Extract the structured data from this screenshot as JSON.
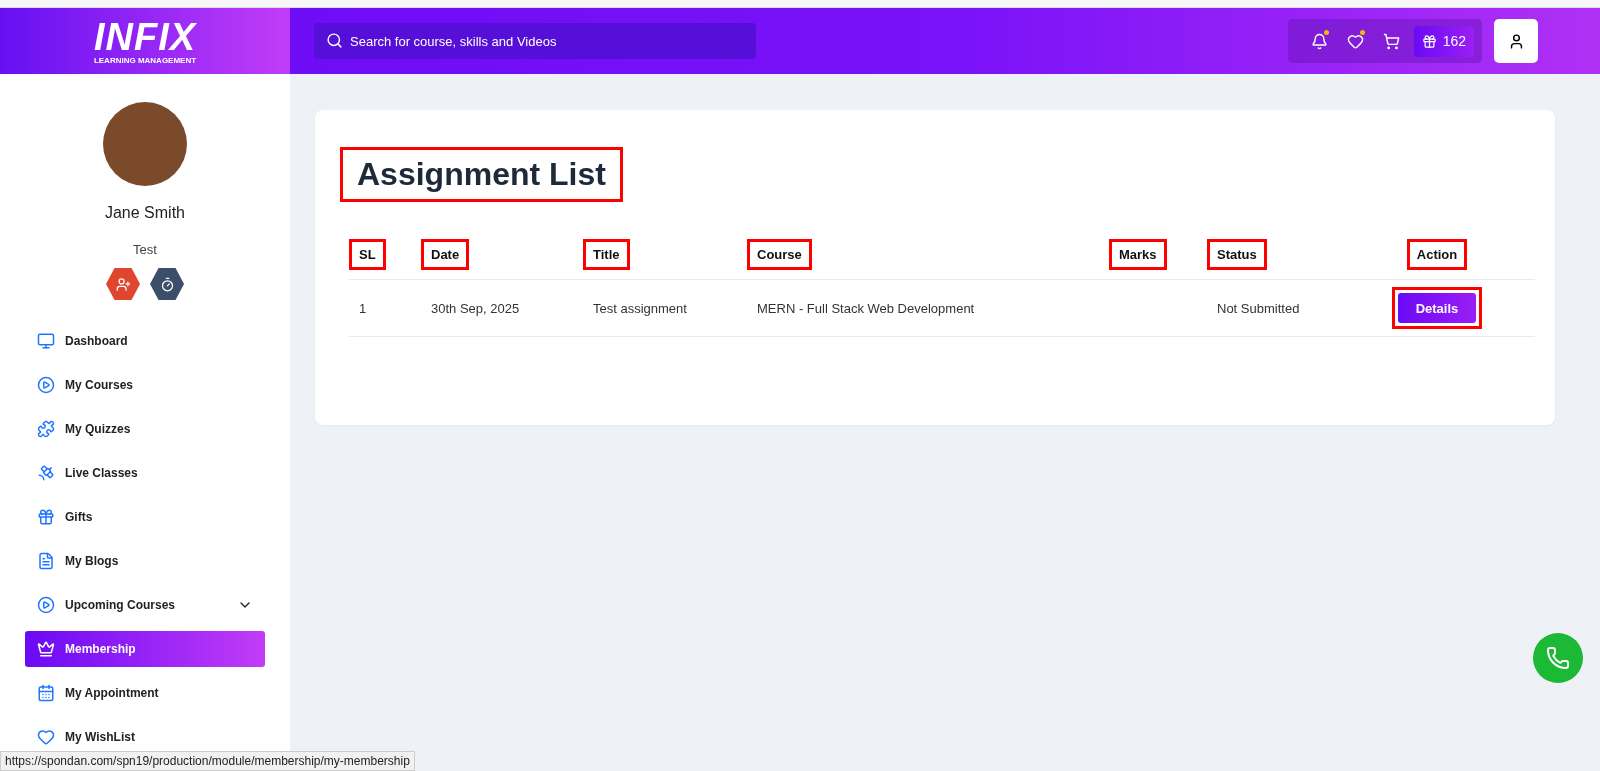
{
  "header": {
    "logo": "INFIX",
    "logo_subtitle": "LEARNING MANAGEMENT",
    "search": {
      "placeholder": "Search for course, skills and Videos"
    },
    "notifications_unread": true,
    "wishlist_unread": true,
    "gift_points": "162"
  },
  "profile": {
    "name": "Jane Smith",
    "role": "Test"
  },
  "sidebar": {
    "items": [
      {
        "kind": "monitor",
        "label": "Dashboard",
        "selected": false
      },
      {
        "kind": "play",
        "label": "My Courses",
        "selected": false
      },
      {
        "kind": "puzzle",
        "label": "My Quizzes",
        "selected": false
      },
      {
        "kind": "satellite",
        "label": "Live Classes",
        "selected": false
      },
      {
        "kind": "gift",
        "label": "Gifts",
        "selected": false
      },
      {
        "kind": "note",
        "label": "My Blogs",
        "selected": false
      },
      {
        "kind": "play",
        "label": "Upcoming Courses",
        "selected": false,
        "expandable": true
      },
      {
        "kind": "crown",
        "label": "Membership",
        "selected": true
      },
      {
        "kind": "calendar",
        "label": "My Appointment",
        "selected": false
      },
      {
        "kind": "heart",
        "label": "My WishList",
        "selected": false
      }
    ]
  },
  "card": {
    "title": "Assignment List",
    "title_annotated": true,
    "table": {
      "columns": [
        {
          "label": "SL",
          "annotated": true
        },
        {
          "label": "Date",
          "annotated": true
        },
        {
          "label": "Title",
          "annotated": true
        },
        {
          "label": "Course",
          "annotated": true
        },
        {
          "label": "Marks",
          "annotated": true
        },
        {
          "label": "Status",
          "annotated": true
        },
        {
          "label": "Action",
          "annotated": true
        }
      ],
      "rows": [
        {
          "sl": "1",
          "date": "30th Sep, 2025",
          "title": "Test assignment",
          "course": "MERN - Full Stack Web Development",
          "marks": "",
          "status": "Not Submitted",
          "action": "Details",
          "action_annotated": true
        }
      ]
    }
  },
  "status_bar": "https://spondan.com/spn19/production/module/membership/my-membership"
}
